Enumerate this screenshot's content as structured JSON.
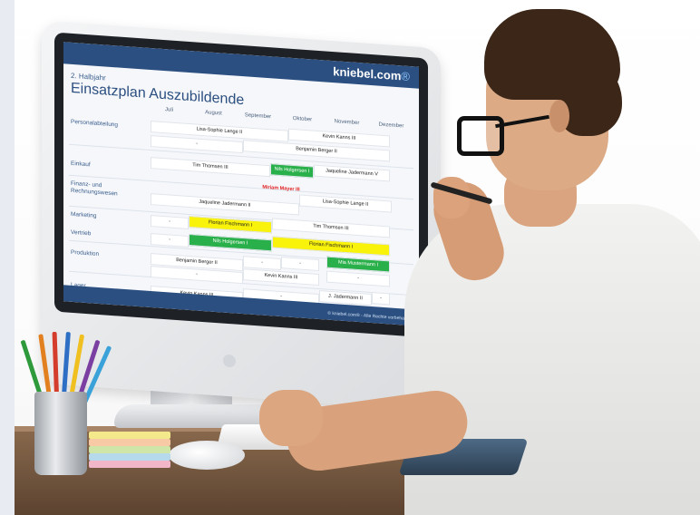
{
  "screen": {
    "brand": "kniebel.com",
    "brand_suffix": "®",
    "subtitle": "2. Halbjahr",
    "title": "Einsatzplan Auszubildende",
    "months": [
      "Juli",
      "August",
      "September",
      "Oktober",
      "November",
      "Dezember"
    ],
    "rows": [
      {
        "label": "Personalabteilung"
      },
      {
        "label": "Einkauf"
      },
      {
        "label": "Finanz- und Rechnungswesen"
      },
      {
        "label": "Marketing"
      },
      {
        "label": "Vertrieb"
      },
      {
        "label": "Produktion"
      },
      {
        "label": "Lager"
      }
    ],
    "cells": [
      "Lisa-Sophie Lange II",
      "Kevin Kanns III",
      "Benjamin Berger II",
      "-",
      "Tim Thomsen III",
      "Nils Holgersen I",
      "Jaqueline Jadermann V",
      "Miriam Mayer III",
      "Lisa-Sophie Lange II",
      "Jaqueline Jadermann II",
      "-",
      "Florian Fischmann I",
      "Tim Thomsen III",
      "-",
      "Nils Holgersen I",
      "Florian Fischmann I",
      "Mia Mustermann I",
      "Benjamin Berger II",
      "-",
      "-",
      "-",
      "Kevin Kanns III",
      "-",
      "Kevin Kanns III",
      "-",
      "J. Jadermann II",
      "-"
    ],
    "footer_copyright": "© kniebel.com® - Alle Rechte vorbehalten"
  },
  "colors": {
    "header": "#2b4f80",
    "green": "#2ab04a",
    "yellow": "#f9f20a",
    "red_text": "#e02020"
  }
}
